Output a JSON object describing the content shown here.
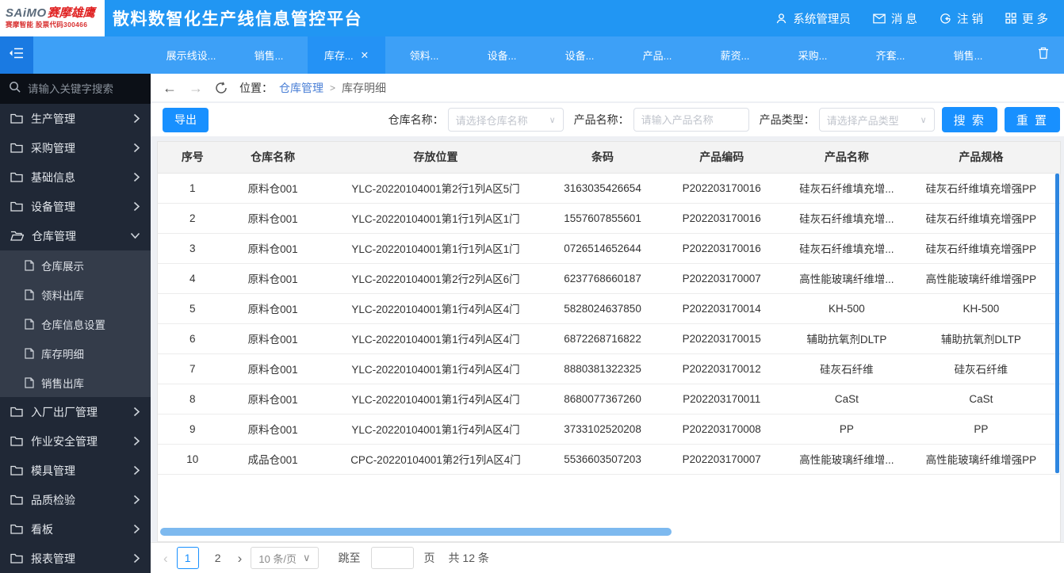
{
  "colors": {
    "c-header": "#2196f3",
    "c-tabbar": "#3da0f7",
    "c-tab-active": "#2492f5",
    "c-collapse": "#1a7ae2",
    "c-accent": "#1890ff",
    "c-sidebar": "#202836",
    "c-sidebar-dark": "#0c1017",
    "c-submenu": "#343c4a",
    "c-link": "#4a7fd6",
    "c-thumb": "#7db9ef"
  },
  "icons": {
    "close": "✕",
    "caret_down": "∨",
    "back": "←",
    "forward": "→",
    "prev": "‹",
    "next": "›"
  },
  "header": {
    "logo": {
      "brand_en": "SAiMO",
      "brand_cn": "赛摩雄鹰",
      "sub": "赛摩智能 股票代码300466"
    },
    "title": "散料数智化生产线信息管控平台",
    "user": "系统管理员",
    "messages_label": "消 息",
    "logout_label": "注 销",
    "more_label": "更 多"
  },
  "tabbar": {
    "tabs": [
      {
        "label": "展示线设...",
        "active": false
      },
      {
        "label": "销售...",
        "active": false
      },
      {
        "label": "库存...",
        "active": true
      },
      {
        "label": "领料...",
        "active": false
      },
      {
        "label": "设备...",
        "active": false
      },
      {
        "label": "设备...",
        "active": false
      },
      {
        "label": "产品...",
        "active": false
      },
      {
        "label": "薪资...",
        "active": false
      },
      {
        "label": "采购...",
        "active": false
      },
      {
        "label": "齐套...",
        "active": false
      },
      {
        "label": "销售...",
        "active": false
      }
    ]
  },
  "sidebar": {
    "search_placeholder": "请输入关键字搜索",
    "items": [
      {
        "label": "生产管理",
        "expanded": false
      },
      {
        "label": "采购管理",
        "expanded": false
      },
      {
        "label": "基础信息",
        "expanded": false
      },
      {
        "label": "设备管理",
        "expanded": false
      },
      {
        "label": "仓库管理",
        "expanded": true,
        "children": [
          "仓库展示",
          "领料出库",
          "仓库信息设置",
          "库存明细",
          "销售出库"
        ]
      },
      {
        "label": "入厂出厂管理",
        "expanded": false
      },
      {
        "label": "作业安全管理",
        "expanded": false
      },
      {
        "label": "模具管理",
        "expanded": false
      },
      {
        "label": "品质检验",
        "expanded": false
      },
      {
        "label": "看板",
        "expanded": false
      },
      {
        "label": "报表管理",
        "expanded": false
      }
    ]
  },
  "breadcrumb": {
    "label": "位置：",
    "parent": "仓库管理",
    "sep": ">",
    "current": "库存明细"
  },
  "filters": {
    "export_label": "导出",
    "warehouse_label": "仓库名称：",
    "warehouse_placeholder": "请选择仓库名称",
    "product_name_label": "产品名称：",
    "product_name_placeholder": "请输入产品名称",
    "product_type_label": "产品类型：",
    "product_type_placeholder": "请选择产品类型",
    "search_label": "搜 索",
    "reset_label": "重 置"
  },
  "table": {
    "columns": [
      "序号",
      "仓库名称",
      "存放位置",
      "条码",
      "产品编码",
      "产品名称",
      "产品规格"
    ],
    "col_widths": [
      "7.7%",
      "10.1%",
      "26%",
      "11%",
      "15.4%",
      "12.3%",
      "17.5%"
    ],
    "rows": [
      [
        "1",
        "原料仓001",
        "YLC-20220104001第2行1列A区5门",
        "3163035426654",
        "P202203170016",
        "硅灰石纤维填充增...",
        "硅灰石纤维填充增强PP"
      ],
      [
        "2",
        "原料仓001",
        "YLC-20220104001第1行1列A区1门",
        "1557607855601",
        "P202203170016",
        "硅灰石纤维填充增...",
        "硅灰石纤维填充增强PP"
      ],
      [
        "3",
        "原料仓001",
        "YLC-20220104001第1行1列A区1门",
        "0726514652644",
        "P202203170016",
        "硅灰石纤维填充增...",
        "硅灰石纤维填充增强PP"
      ],
      [
        "4",
        "原料仓001",
        "YLC-20220104001第2行2列A区6门",
        "6237768660187",
        "P202203170007",
        "高性能玻璃纤维增...",
        "高性能玻璃纤维增强PP"
      ],
      [
        "5",
        "原料仓001",
        "YLC-20220104001第1行4列A区4门",
        "5828024637850",
        "P202203170014",
        "KH-500",
        "KH-500"
      ],
      [
        "6",
        "原料仓001",
        "YLC-20220104001第1行4列A区4门",
        "6872268716822",
        "P202203170015",
        "辅助抗氧剂DLTP",
        "辅助抗氧剂DLTP"
      ],
      [
        "7",
        "原料仓001",
        "YLC-20220104001第1行4列A区4门",
        "8880381322325",
        "P202203170012",
        "硅灰石纤维",
        "硅灰石纤维"
      ],
      [
        "8",
        "原料仓001",
        "YLC-20220104001第1行4列A区4门",
        "8680077367260",
        "P202203170011",
        "CaSt",
        "CaSt"
      ],
      [
        "9",
        "原料仓001",
        "YLC-20220104001第1行4列A区4门",
        "3733102520208",
        "P202203170008",
        "PP",
        "PP"
      ],
      [
        "10",
        "成品仓001",
        "CPC-20220104001第2行1列A区4门",
        "5536603507203",
        "P202203170007",
        "高性能玻璃纤维增...",
        "高性能玻璃纤维增强PP"
      ]
    ]
  },
  "pagination": {
    "pages": [
      "1",
      "2"
    ],
    "active_page": "1",
    "page_size": "10 条/页",
    "jump_label": "跳至",
    "page_suffix": "页",
    "total": "共 12 条"
  }
}
